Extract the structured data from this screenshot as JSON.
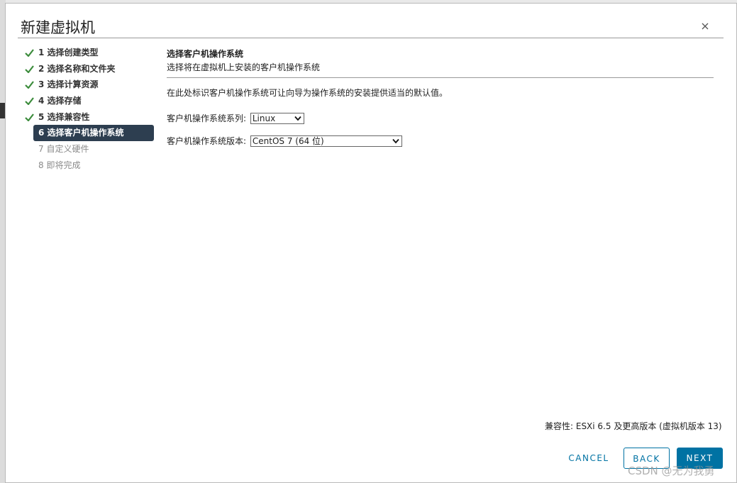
{
  "dialog": {
    "title": "新建虚拟机",
    "close_icon": "close-icon"
  },
  "steps": [
    {
      "label": "1 选择创建类型",
      "state": "done"
    },
    {
      "label": "2 选择名称和文件夹",
      "state": "done"
    },
    {
      "label": "3 选择计算资源",
      "state": "done"
    },
    {
      "label": "4 选择存储",
      "state": "done"
    },
    {
      "label": "5 选择兼容性",
      "state": "done"
    },
    {
      "label": "6 选择客户机操作系统",
      "state": "active"
    },
    {
      "label": "7 自定义硬件",
      "state": "todo"
    },
    {
      "label": "8 即将完成",
      "state": "todo"
    }
  ],
  "section": {
    "title": "选择客户机操作系统",
    "subtitle": "选择将在虚拟机上安装的客户机操作系统",
    "description": "在此处标识客户机操作系统可让向导为操作系统的安装提供适当的默认值。"
  },
  "os_family": {
    "label": "客户机操作系统系列:",
    "value": "Linux"
  },
  "os_version": {
    "label": "客户机操作系统版本:",
    "value": "CentOS 7 (64 位)"
  },
  "compatibility": "兼容性: ESXi 6.5 及更高版本 (虚拟机版本 13)",
  "buttons": {
    "cancel": "CANCEL",
    "back": "BACK",
    "next": "NEXT"
  },
  "watermark": "CSDN @无为我勇",
  "colors": {
    "accent": "#0072a3",
    "check": "#3c8c3c",
    "active_step_bg": "#2d3e50"
  }
}
